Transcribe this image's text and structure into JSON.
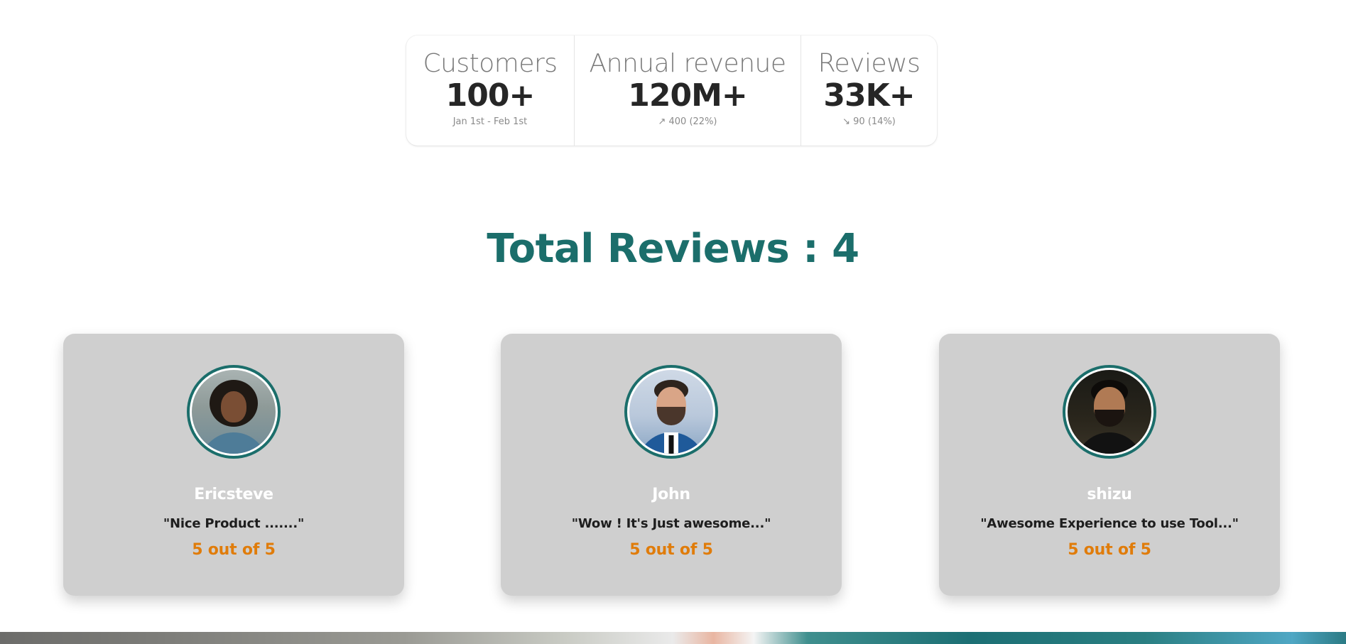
{
  "stats": [
    {
      "title": "Customers",
      "value": "100+",
      "desc": "Jan 1st - Feb 1st"
    },
    {
      "title": "Annual revenue",
      "value": "120M+",
      "desc": "↗ 400 (22%)"
    },
    {
      "title": "Reviews",
      "value": "33K+",
      "desc": "↘ 90 (14%)"
    }
  ],
  "reviews_section": {
    "heading": "Total Reviews : 4"
  },
  "reviews": [
    {
      "name": "Ericsteve",
      "text": "\"Nice Product .......\"",
      "rating": "5 out of 5",
      "avatar": "reviewer-photo-woman"
    },
    {
      "name": "John",
      "text": "\"Wow ! It's Just awesome...\"",
      "rating": "5 out of 5",
      "avatar": "reviewer-photo-man-suit"
    },
    {
      "name": "shizu",
      "text": "\"Awesome Experience to use Tool...\"",
      "rating": "5 out of 5",
      "avatar": "reviewer-photo-man-beard"
    }
  ],
  "colors": {
    "accent": "#1b6e6b",
    "rating": "#e07c0a",
    "card_bg": "#cfcfcf"
  }
}
